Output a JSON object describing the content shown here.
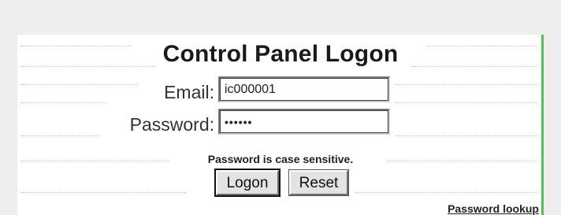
{
  "panel": {
    "title": "Control Panel Logon",
    "accent_color": "#4ac74a"
  },
  "form": {
    "email_label": "Email:",
    "email_value": "ic000001",
    "password_label": "Password:",
    "password_value": "••••••",
    "hint": "Password is case sensitive."
  },
  "buttons": {
    "logon_label": "Logon",
    "reset_label": "Reset"
  },
  "links": {
    "password_lookup": "Password lookup"
  }
}
